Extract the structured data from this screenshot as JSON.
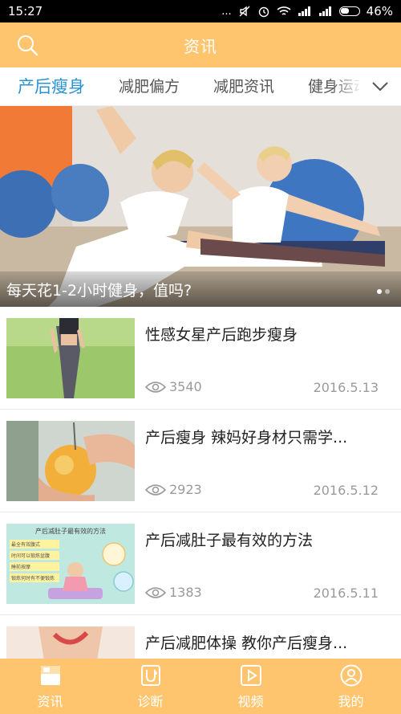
{
  "status_bar": {
    "time": "15:27",
    "signal_text": "...",
    "battery": "46%"
  },
  "header": {
    "title": "资讯"
  },
  "tabs": [
    {
      "label": "产后瘦身",
      "active": true
    },
    {
      "label": "减肥偏方",
      "active": false
    },
    {
      "label": "减肥资讯",
      "active": false
    },
    {
      "label": "健身运动",
      "active": false
    }
  ],
  "banner": {
    "caption": "每天花1-2小时健身，值吗?",
    "slide_count": 2,
    "active_slide": 1
  },
  "news": [
    {
      "title": "性感女星产后跑步瘦身",
      "views": "3540",
      "date": "2016.5.13"
    },
    {
      "title": "产后瘦身 辣妈好身材只需学...",
      "views": "2923",
      "date": "2016.5.12"
    },
    {
      "title": "产后减肚子最有效的方法",
      "views": "1383",
      "date": "2016.5.11"
    },
    {
      "title": "产后减肥体操 教你产后瘦身...",
      "views": "",
      "date": ""
    }
  ],
  "thumb3": {
    "heading": "产后减肚子最有效的方法",
    "steps": [
      "最全有效腹式",
      "时间可以锻炼盆腹",
      "睡前按摩",
      "锻炼何时有不便锻炼"
    ]
  },
  "bottom_nav": [
    {
      "label": "资讯",
      "icon": "news-icon"
    },
    {
      "label": "诊断",
      "icon": "diagnosis-icon"
    },
    {
      "label": "视频",
      "icon": "video-icon"
    },
    {
      "label": "我的",
      "icon": "profile-icon"
    }
  ],
  "colors": {
    "accent": "#ffc56e",
    "tab_active": "#2a93d5"
  }
}
